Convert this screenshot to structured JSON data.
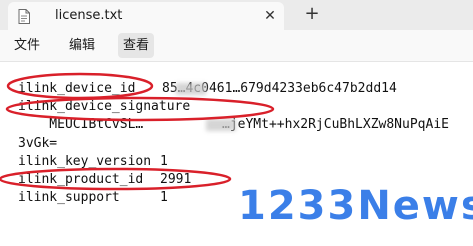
{
  "tab": {
    "title": "license.txt",
    "close_icon": "✕",
    "new_tab_icon": "+"
  },
  "menu": [
    "文件",
    "编辑",
    "查看"
  ],
  "lines": [
    {
      "key": "ilink_device_id",
      "value": "85…4c0461…679d4233eb6c47b2dd14"
    },
    {
      "key": "ilink_device_signature",
      "value": ""
    },
    {
      "key": "    MEUCIBtCvSL…",
      "value": "…jeYMt++hx2RjCuBhLXZw8NuPqAiE"
    },
    {
      "key": "3vGk=",
      "value": ""
    },
    {
      "key": "ilink_key_version",
      "value": "1"
    },
    {
      "key": "ilink_product_id",
      "value": "2991"
    },
    {
      "key": "ilink_support",
      "value": "1"
    }
  ],
  "watermark": "1233News",
  "colors": {
    "annotation": "#d9202a",
    "watermark": "#3b7fe8"
  }
}
